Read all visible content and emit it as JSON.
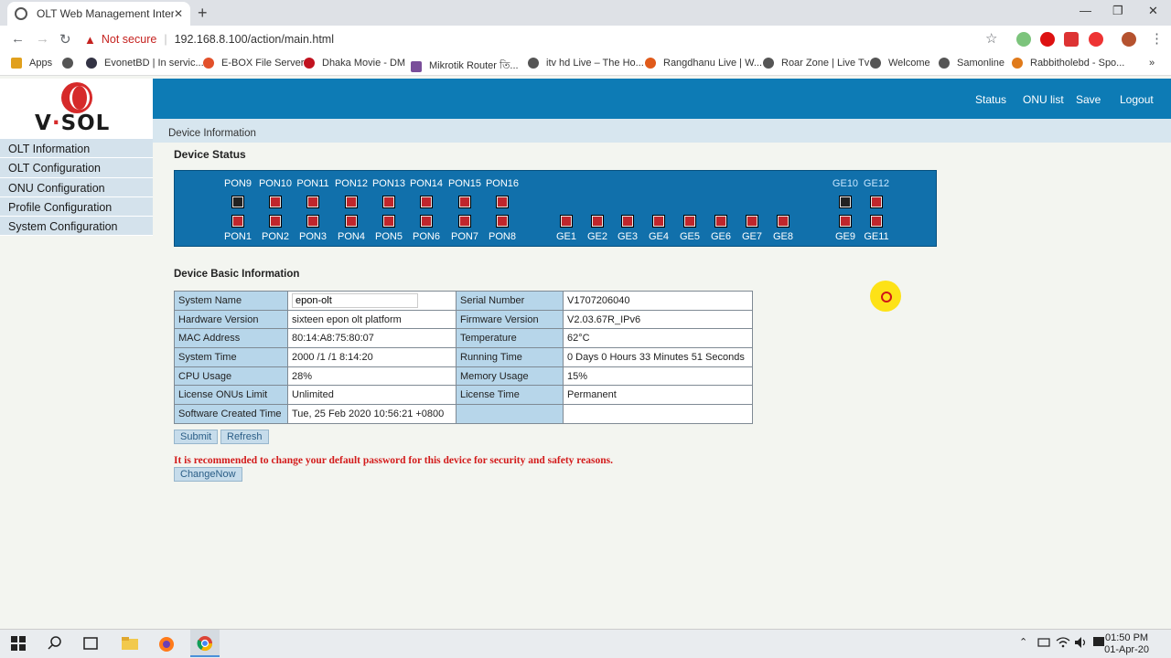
{
  "browser": {
    "tab_title": "OLT Web Management Interface",
    "tab_close": "✕",
    "new_tab": "+",
    "win_minimize": "—",
    "win_restore": "❐",
    "win_close": "✕",
    "security_label": "Not secure",
    "url": "192.168.8.100/action/main.html",
    "bookmarks": [
      "Apps",
      "EvonetBD | In servic...",
      "E-BOX File Server",
      "Dhaka Movie - DM",
      "Mikrotik Router তি...",
      "itv hd Live – The Ho...",
      "Rangdhanu Live | W...",
      "Roar Zone | Live Tv",
      "Welcome",
      "Samonline",
      "Rabbitholebd - Spo..."
    ]
  },
  "header": {
    "logo_text_left": "V",
    "logo_dot": "·",
    "logo_text_right": "SOL",
    "links": [
      "Status",
      "ONU list",
      "Save",
      "Logout"
    ],
    "breadcrumb": "Device Information"
  },
  "sidebar": {
    "items": [
      "OLT Information",
      "OLT Configuration",
      "ONU Configuration",
      "Profile Configuration",
      "System Configuration"
    ]
  },
  "device_status": {
    "title": "Device Status",
    "top_pon_labels": [
      "PON9",
      "PON10",
      "PON11",
      "PON12",
      "PON13",
      "PON14",
      "PON15",
      "PON16"
    ],
    "bottom_pon_labels": [
      "PON1",
      "PON2",
      "PON3",
      "PON4",
      "PON5",
      "PON6",
      "PON7",
      "PON8"
    ],
    "ge_labels": [
      "GE1",
      "GE2",
      "GE3",
      "GE4",
      "GE5",
      "GE6",
      "GE7",
      "GE8"
    ],
    "top_ge_labels": [
      "GE10",
      "GE12"
    ],
    "bottom_ge_labels": [
      "GE9",
      "GE11"
    ]
  },
  "basic_info": {
    "title": "Device Basic Information",
    "system_name_label": "System Name",
    "system_name_value": "epon-olt",
    "rows": [
      {
        "k1": "Hardware Version",
        "v1": "sixteen epon olt platform",
        "k2": "Firmware Version",
        "v2": "V2.03.67R_IPv6"
      },
      {
        "k1": "MAC Address",
        "v1": "80:14:A8:75:80:07",
        "k2": "Temperature",
        "v2": "62°C"
      },
      {
        "k1": "System Time",
        "v1": "2000 /1 /1 8:14:20",
        "k2": "Running Time",
        "v2": "0 Days 0 Hours 33 Minutes 51 Seconds"
      },
      {
        "k1": "CPU Usage",
        "v1": "28%",
        "k2": "Memory Usage",
        "v2": "15%"
      },
      {
        "k1": "License ONUs Limit",
        "v1": "Unlimited",
        "k2": "License Time",
        "v2": "Permanent"
      },
      {
        "k1": "Software Created Time",
        "v1": "Tue, 25 Feb 2020 10:56:21 +0800",
        "k2": "",
        "v2": ""
      }
    ],
    "serial_label": "Serial Number",
    "serial_value": "V1707206040",
    "submit": "Submit",
    "refresh": "Refresh",
    "warning": "It is recommended to change your default password for this device for security and safety reasons.",
    "change_now": "ChangeNow"
  },
  "taskbar": {
    "time": "01:50 PM",
    "date": "01-Apr-20"
  }
}
